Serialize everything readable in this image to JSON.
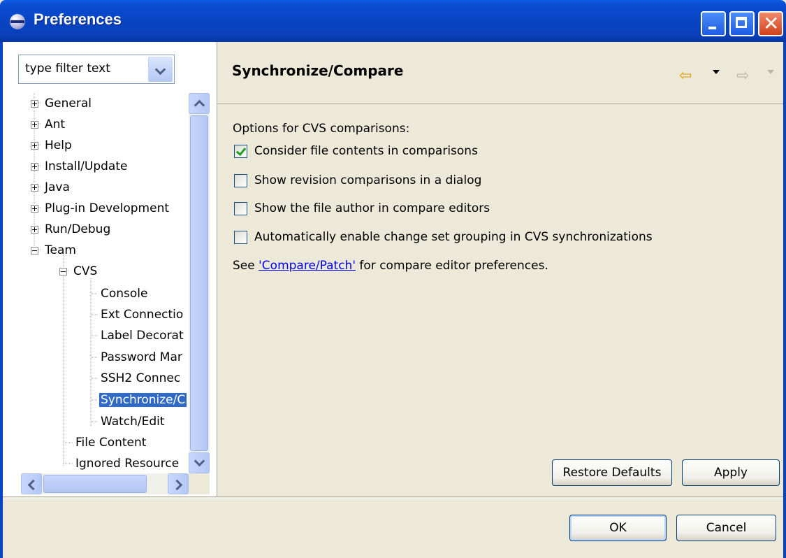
{
  "window": {
    "title": "Preferences"
  },
  "filter": {
    "placeholder": "type filter text"
  },
  "tree": {
    "items": [
      "General",
      "Ant",
      "Help",
      "Install/Update",
      "Java",
      "Plug-in Development",
      "Run/Debug",
      "Team",
      "CVS",
      "Console",
      "Ext Connectio",
      "Label Decorat",
      "Password Mar",
      "SSH2 Connec",
      "Synchronize/C",
      "Watch/Edit",
      "File Content",
      "Ignored Resource"
    ],
    "selected": "Synchronize/C"
  },
  "page": {
    "title": "Synchronize/Compare",
    "options_label": "Options for CVS comparisons:",
    "options": [
      {
        "label": "Consider file contents in comparisons",
        "checked": true
      },
      {
        "label": "Show revision comparisons in a dialog",
        "checked": false
      },
      {
        "label": "Show the file author in compare editors",
        "checked": false
      },
      {
        "label": "Automatically enable change set grouping in CVS synchronizations",
        "checked": false
      }
    ],
    "see_prefix": "See ",
    "see_link": "'Compare/Patch'",
    "see_suffix": " for compare editor preferences."
  },
  "buttons": {
    "restore": "Restore Defaults",
    "apply": "Apply",
    "ok": "OK",
    "cancel": "Cancel"
  }
}
